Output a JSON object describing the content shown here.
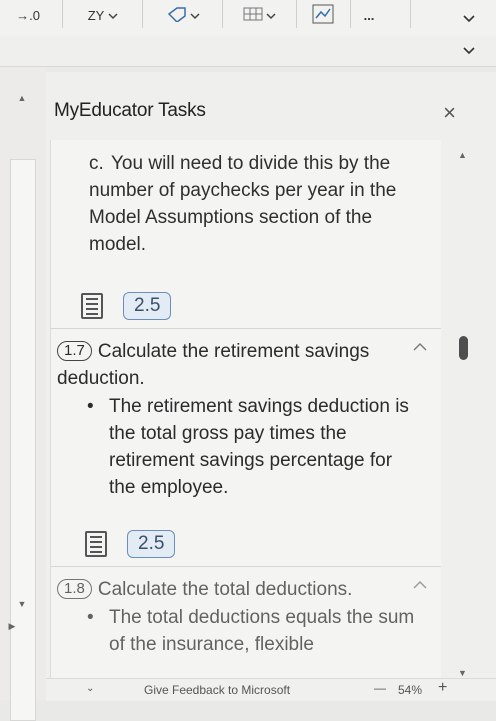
{
  "ribbon": {
    "decimal_label": "→.0",
    "sort_label": "ZY",
    "more_label": "..."
  },
  "pane": {
    "title": "MyEducator Tasks",
    "close_label": "×"
  },
  "content": {
    "sub_c": {
      "label": "c.",
      "text": "You will need to divide this by the number of paychecks per year in the Model Assumptions section of the model."
    },
    "ref_1": "2.5",
    "task_17": {
      "number": "1.7",
      "title": "Calculate the retirement savings deduction.",
      "bullet": "The retirement savings deduction is the total gross pay times the retirement savings percentage for the employee."
    },
    "ref_2": "2.5",
    "task_18": {
      "number": "1.8",
      "title": "Calculate the total deductions.",
      "bullet": "The total deductions equals the sum of the insurance, flexible"
    }
  },
  "status": {
    "feedback": "Give Feedback to Microsoft",
    "zoom_minus": "—",
    "zoom": "54%",
    "zoom_plus": "+"
  }
}
